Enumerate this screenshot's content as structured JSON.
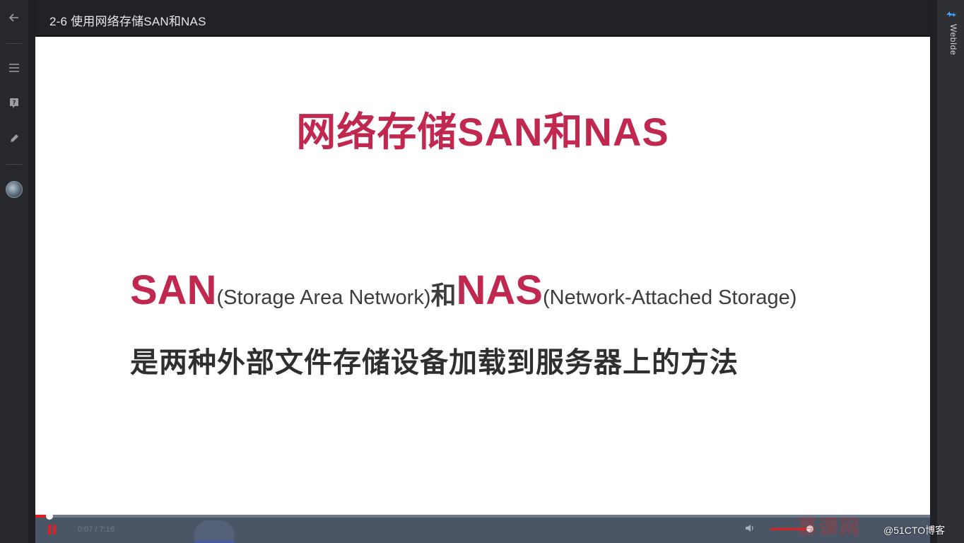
{
  "header": {
    "title": "2-6 使用网络存储SAN和NAS"
  },
  "sidebar": {
    "icons": [
      "back-arrow-icon",
      "menu-icon",
      "help-icon",
      "edit-icon",
      "avatar-globe-icon"
    ]
  },
  "rightpanel": {
    "label": "WebIde"
  },
  "slide": {
    "title": "网络存储SAN和NAS",
    "san": "SAN",
    "san_full": "(Storage Area Network)",
    "he": "和",
    "nas": "NAS",
    "nas_full": "(Network-Attached Storage)",
    "line2": "是两种外部文件存储设备加载到服务器上的方法"
  },
  "player": {
    "time": "0:07 / 7:16",
    "progress": 0.016,
    "volume": 0.9,
    "accent_color": "#e02020"
  },
  "logo": {
    "text": "慕课网"
  },
  "watermark": "@51CTO博客"
}
